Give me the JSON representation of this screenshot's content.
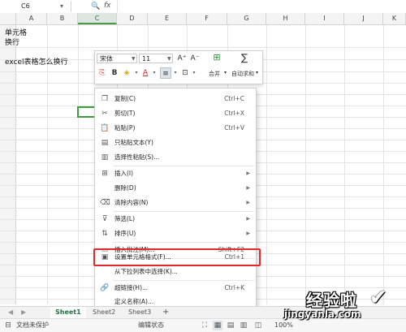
{
  "formula_bar": {
    "name_box": "C6",
    "zoom_icon": "🔍",
    "fx": "fx",
    "formula": ""
  },
  "columns": [
    "A",
    "B",
    "C",
    "D",
    "E",
    "F",
    "G",
    "H",
    "I",
    "J",
    "K"
  ],
  "active_column": "C",
  "cells": {
    "a1_line1": "单元格",
    "a1_line2": "换行",
    "a3": "excel表格怎么换行"
  },
  "mini_toolbar": {
    "font_name": "宋体",
    "font_size": "11",
    "grow_font": "A⁺",
    "shrink_font": "A⁻",
    "bold": "B",
    "merge_label": "合并",
    "autosum_label": "自动求和"
  },
  "context_menu": [
    {
      "label": "复制(C)",
      "shortcut": "Ctrl+C",
      "icon": "copy-icon",
      "glyph": "❐"
    },
    {
      "label": "剪切(T)",
      "shortcut": "Ctrl+X",
      "icon": "cut-icon",
      "glyph": "✂"
    },
    {
      "label": "粘贴(P)",
      "shortcut": "Ctrl+V",
      "icon": "paste-icon",
      "glyph": "📋"
    },
    {
      "label": "只粘贴文本(Y)",
      "shortcut": "",
      "icon": "paste-text-icon",
      "glyph": "▤"
    },
    {
      "label": "选择性粘贴(S)...",
      "shortcut": "",
      "icon": "paste-special-icon",
      "glyph": "▥"
    },
    {
      "label": "插入(I)",
      "shortcut": "",
      "icon": "insert-icon",
      "glyph": "⊞",
      "submenu": true
    },
    {
      "label": "删除(D)",
      "shortcut": "",
      "icon": "",
      "glyph": "",
      "submenu": true
    },
    {
      "label": "清除内容(N)",
      "shortcut": "",
      "icon": "clear-icon",
      "glyph": "⌫",
      "submenu": true
    },
    {
      "label": "筛选(L)",
      "shortcut": "",
      "icon": "filter-icon",
      "glyph": "⊽",
      "submenu": true
    },
    {
      "label": "排序(U)",
      "shortcut": "",
      "icon": "sort-icon",
      "glyph": "⇅",
      "submenu": true
    },
    {
      "label": "插入批注(M)...",
      "shortcut": "Shift+F2",
      "icon": "comment-icon",
      "glyph": "▭"
    },
    {
      "label": "设置单元格格式(F)...",
      "shortcut": "Ctrl+1",
      "icon": "format-cells-icon",
      "glyph": "▣"
    },
    {
      "label": "从下拉列表中选择(K)...",
      "shortcut": "",
      "icon": "",
      "glyph": ""
    },
    {
      "label": "超链接(H)...",
      "shortcut": "Ctrl+K",
      "icon": "link-icon",
      "glyph": "🔗"
    },
    {
      "label": "定义名称(A)...",
      "shortcut": "",
      "icon": "",
      "glyph": ""
    }
  ],
  "sheet_tabs": [
    "Sheet1",
    "Sheet2",
    "Sheet3"
  ],
  "active_sheet": "Sheet1",
  "status_bar": {
    "doc_status": "文档未保护",
    "edit_mode": "编辑状态",
    "zoom": "100%"
  },
  "watermark": {
    "title": "经验啦",
    "url": "jingyanla.com"
  },
  "colors": {
    "selection_green": "#3f9b3f",
    "highlight_red": "#e02b2b",
    "sheet_tab_green": "#217346"
  }
}
